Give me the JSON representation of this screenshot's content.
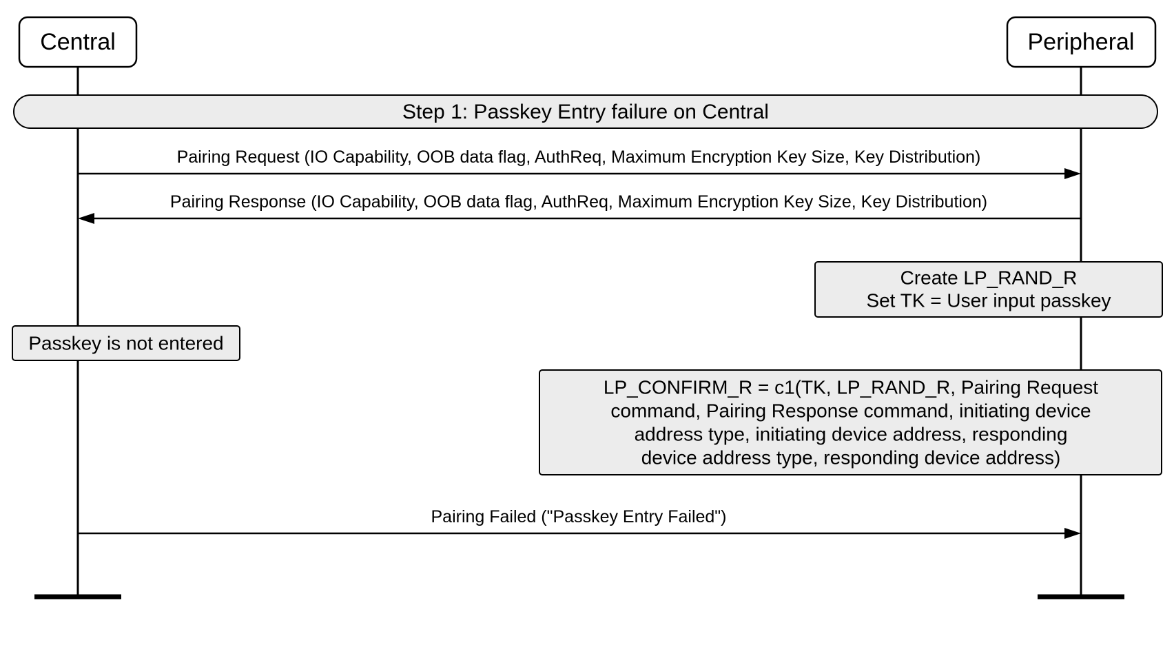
{
  "participants": {
    "left": "Central",
    "right": "Peripheral"
  },
  "step_title": "Step 1: Passkey Entry failure on Central",
  "messages": {
    "m1": "Pairing Request (IO Capability, OOB data flag, AuthReq, Maximum Encryption Key Size, Key Distribution)",
    "m2": "Pairing Response (IO Capability, OOB data flag, AuthReq, Maximum Encryption Key Size, Key Distribution)",
    "m3": "Pairing Failed (\"Passkey Entry Failed\")"
  },
  "notes": {
    "right1_line1": "Create LP_RAND_R",
    "right1_line2": "Set TK = User input passkey",
    "left1": "Passkey is not entered",
    "right2_line1": "LP_CONFIRM_R = c1(TK, LP_RAND_R, Pairing Request",
    "right2_line2": "command, Pairing Response command, initiating device",
    "right2_line3": "address type, initiating device address, responding",
    "right2_line4": "device address type, responding device address)"
  }
}
